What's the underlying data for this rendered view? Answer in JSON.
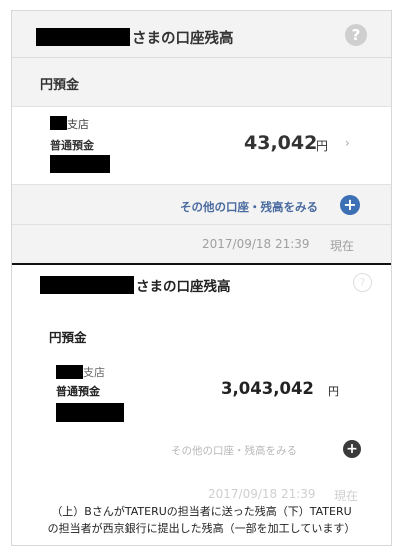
{
  "top_panel": {
    "title_suffix": "さまの口座残高",
    "help_icon": "question-circle-icon",
    "help_glyph": "?",
    "currency_heading": "円預金",
    "account": {
      "branch_suffix": "支店",
      "type": "普通預金",
      "amount": "43,042",
      "currency_unit": "円",
      "chevron": "›"
    },
    "other_accounts_link": "その他の口座・残高をみる",
    "plus_glyph": "+",
    "timestamp": "2017/09/18 21:39",
    "timestamp_suffix": "現在",
    "colors": {
      "link": "#4a6ba0",
      "plus_button": "#3d6fb5"
    }
  },
  "bottom_panel": {
    "title_suffix": "さまの口座残高",
    "help_glyph": "?",
    "currency_heading": "円預金",
    "account": {
      "branch_suffix": "支店",
      "type": "普通預金",
      "amount": "3,043,042",
      "currency_unit": "円"
    },
    "other_accounts_link": "その他の口座・残高をみる",
    "plus_glyph": "+",
    "timestamp": "2017/09/18 21:39",
    "timestamp_suffix": "現在"
  },
  "caption": {
    "line1": "（上）BさんがTATERUの担当者に送った残高（下）TATERU",
    "line2": "の担当者が西京銀行に提出した残高（一部を加工しています）"
  }
}
